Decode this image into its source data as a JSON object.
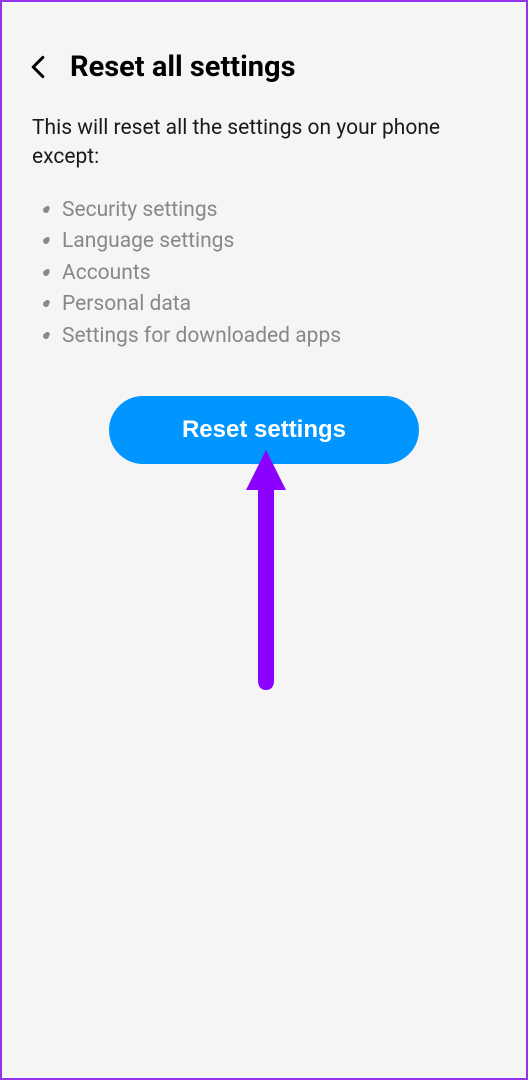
{
  "header": {
    "title": "Reset all settings"
  },
  "description": "This will reset all the settings on your phone except:",
  "exceptions": [
    "Security settings",
    "Language settings",
    "Accounts",
    "Personal data",
    "Settings for downloaded apps"
  ],
  "button": {
    "label": "Reset settings"
  },
  "colors": {
    "accent": "#0095ff",
    "border": "#9333ea",
    "arrow": "#8b00ff"
  }
}
